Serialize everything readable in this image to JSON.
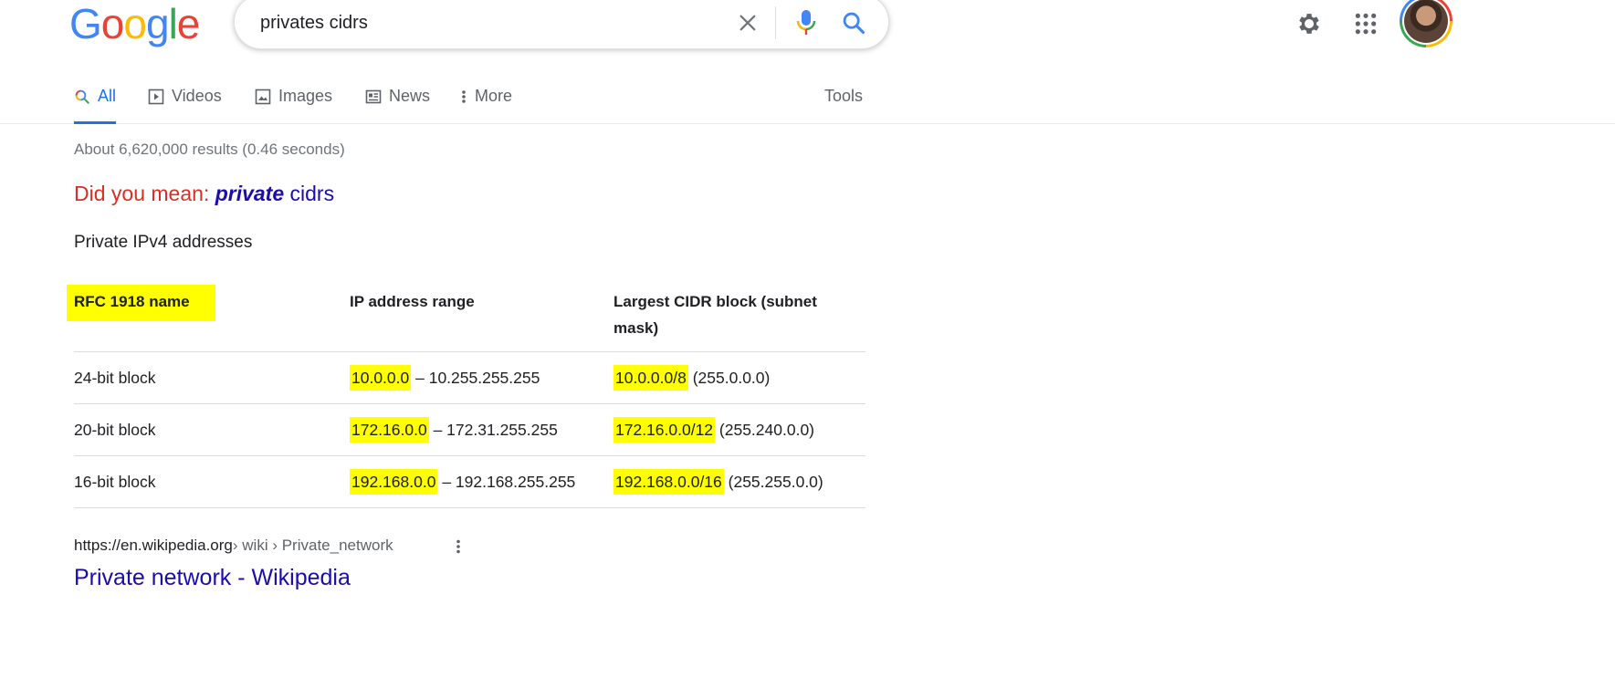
{
  "header": {
    "logo": {
      "letters": [
        "G",
        "o",
        "o",
        "g",
        "l",
        "e"
      ],
      "colors": [
        "#4285f4",
        "#ea4335",
        "#fbbc05",
        "#4285f4",
        "#34a853",
        "#ea4335"
      ]
    },
    "search": {
      "value": "privates cidrs"
    }
  },
  "tabs": {
    "items": [
      {
        "label": "All",
        "icon": "search-icon",
        "active": true
      },
      {
        "label": "Videos",
        "icon": "video-icon"
      },
      {
        "label": "Images",
        "icon": "image-icon"
      },
      {
        "label": "News",
        "icon": "news-icon"
      },
      {
        "label": "More",
        "icon": "more-vertical-icon"
      }
    ],
    "tools_label": "Tools"
  },
  "results": {
    "stats": "About 6,620,000 results (0.46 seconds)",
    "did_you_mean": {
      "label": "Did you mean: ",
      "bold_word": "private",
      "rest": " cidrs"
    },
    "snippet": {
      "title": "Private IPv4 addresses",
      "headers": [
        "RFC 1918 name",
        "IP address range",
        "Largest CIDR block (subnet mask)"
      ],
      "rows": [
        {
          "name": "24-bit block",
          "range_start": "10.0.0.0",
          "range_rest": " – 10.255.255.255",
          "cidr": "10.0.0.0/8",
          "mask": " (255.0.0.0)"
        },
        {
          "name": "20-bit block",
          "range_start": "172.16.0.0",
          "range_rest": " – 172.31.255.255",
          "cidr": "172.16.0.0/12",
          "mask": " (255.240.0.0)"
        },
        {
          "name": "16-bit block",
          "range_start": "192.168.0.0",
          "range_rest": " – 192.168.255.255",
          "cidr": "192.168.0.0/16",
          "mask": " (255.255.0.0)"
        }
      ],
      "highlight_color": "#ffff00"
    },
    "first_result": {
      "cite_domain": "https://en.wikipedia.org",
      "cite_path": " › wiki › Private_network",
      "title": "Private network - Wikipedia"
    }
  },
  "colors": {
    "link": "#1a0dab",
    "accent": "#1a73e8",
    "did_you_mean_label": "#d93025"
  }
}
